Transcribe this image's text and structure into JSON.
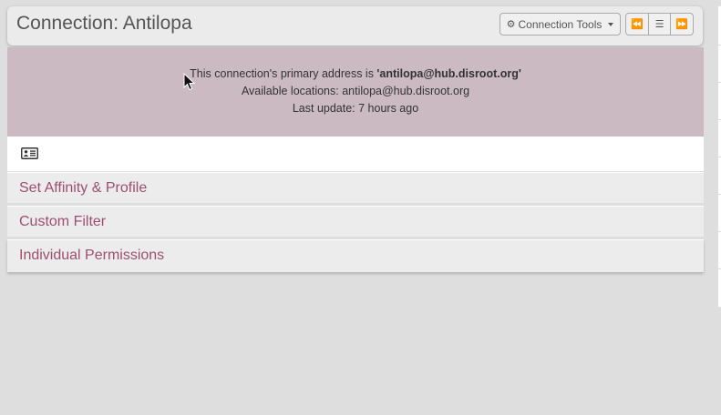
{
  "header": {
    "title": "Connection: Antilopa",
    "tools_label": "Connection Tools",
    "tools_icon": "gear-icon",
    "nav": {
      "first_icon": "fast-backward-icon",
      "menu_icon": "bars-icon",
      "last_icon": "fast-forward-icon"
    }
  },
  "info": {
    "primary_prefix": "This connection's primary address is ",
    "primary_address": "'antilopa@hub.disroot.org'",
    "locations": "Available locations: antilopa@hub.disroot.org",
    "last_update": "Last update: 7 hours ago",
    "background_color": "#cbbac2"
  },
  "vcard": {
    "icon": "vcard-icon"
  },
  "sections": [
    {
      "label": "Set Affinity & Profile"
    },
    {
      "label": "Custom Filter"
    },
    {
      "label": "Individual Permissions"
    }
  ],
  "colors": {
    "accent": "#9d4f6f",
    "page_background": "#dfdedf"
  }
}
